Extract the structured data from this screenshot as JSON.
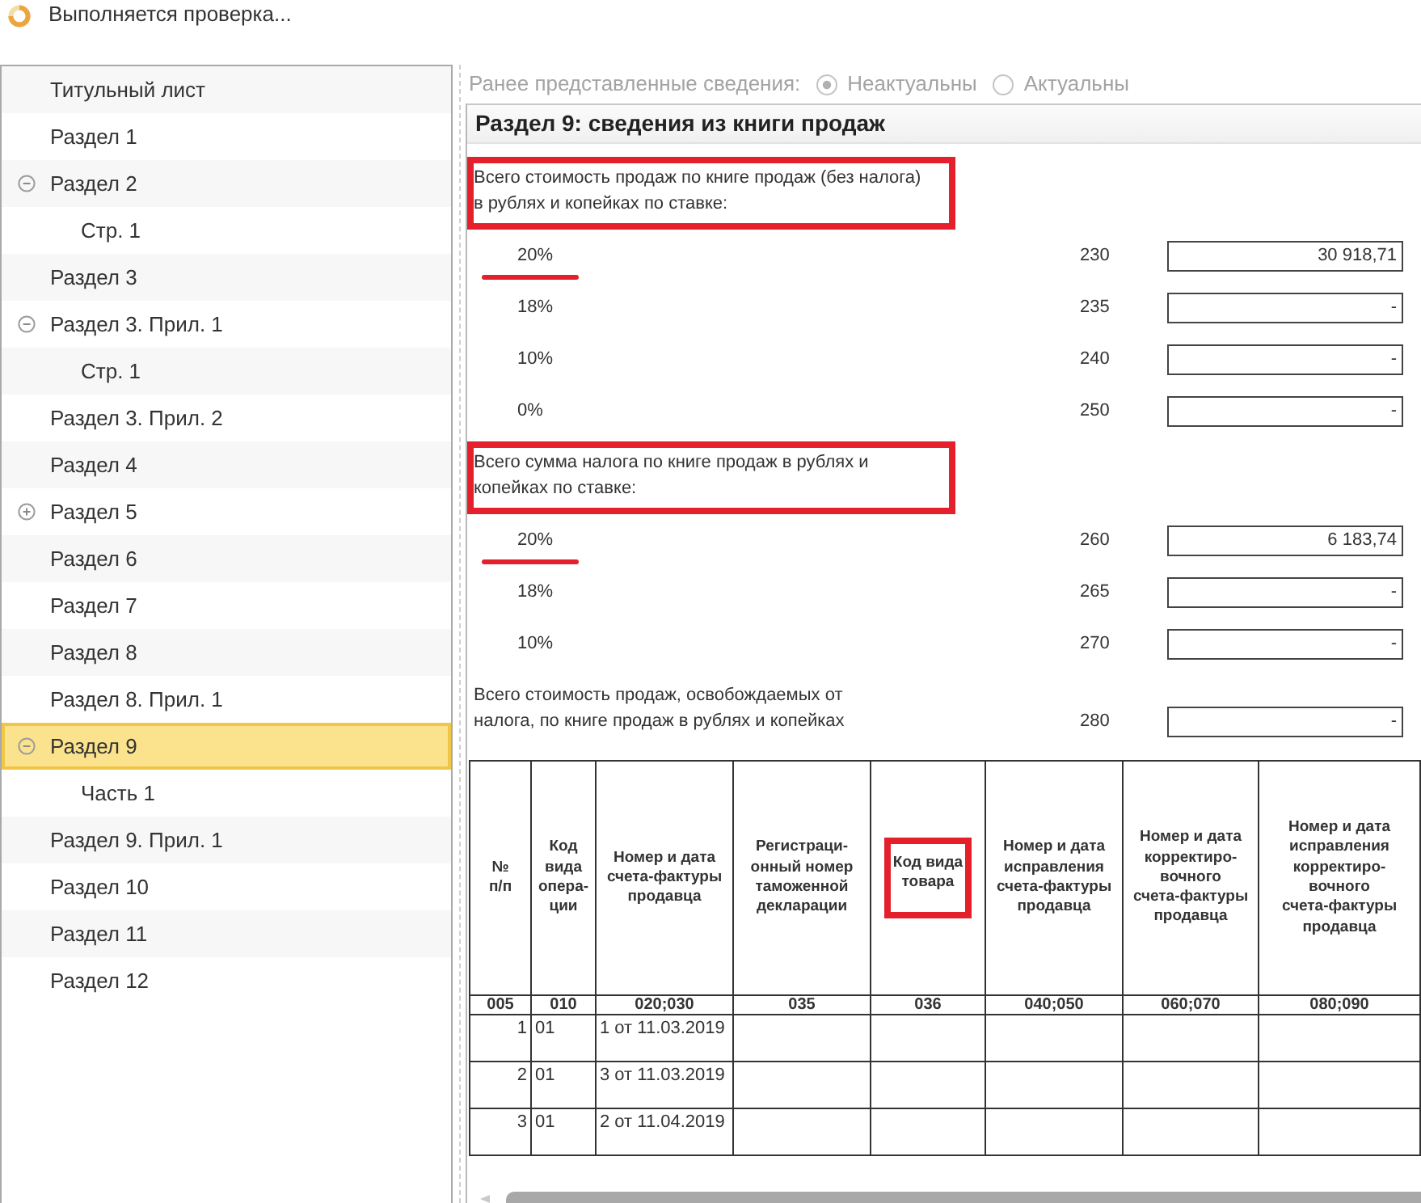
{
  "status": {
    "text": "Выполняется проверка..."
  },
  "sidebar": {
    "items": [
      {
        "label": "Титульный лист",
        "selected": false
      },
      {
        "label": "Раздел 1",
        "selected": false
      },
      {
        "label": "Раздел 2",
        "selected": false,
        "expanded": true,
        "children": [
          {
            "label": "Стр. 1",
            "selected": false
          }
        ]
      },
      {
        "label": "Раздел 3",
        "selected": false
      },
      {
        "label": "Раздел 3. Прил. 1",
        "selected": false,
        "expanded": true,
        "children": [
          {
            "label": "Стр. 1",
            "selected": false
          }
        ]
      },
      {
        "label": "Раздел 3. Прил. 2",
        "selected": false
      },
      {
        "label": "Раздел 4",
        "selected": false
      },
      {
        "label": "Раздел 5",
        "selected": false,
        "expanded": false
      },
      {
        "label": "Раздел 6",
        "selected": false
      },
      {
        "label": "Раздел 7",
        "selected": false
      },
      {
        "label": "Раздел 8",
        "selected": false
      },
      {
        "label": "Раздел 8. Прил. 1",
        "selected": false
      },
      {
        "label": "Раздел 9",
        "selected": true,
        "expanded": true,
        "children": [
          {
            "label": "Часть 1",
            "selected": false
          }
        ]
      },
      {
        "label": "Раздел 9. Прил. 1",
        "selected": false
      },
      {
        "label": "Раздел 10",
        "selected": false
      },
      {
        "label": "Раздел 11",
        "selected": false
      },
      {
        "label": "Раздел 12",
        "selected": false
      }
    ]
  },
  "previous_data": {
    "label": "Ранее представленные сведения:",
    "disabled": true,
    "options": [
      {
        "label": "Неактуальны",
        "selected": true
      },
      {
        "label": "Актуальны",
        "selected": false
      }
    ]
  },
  "form": {
    "title": "Раздел 9: сведения из книги продаж",
    "groups": [
      {
        "kind": "rates",
        "label": "Всего стоимость продаж по книге продаж (без налога) в рублях и копейках по ставке:",
        "annotated": true,
        "rates": [
          {
            "rate": "20%",
            "code": "230",
            "value": "30 918,71",
            "underlined": true
          },
          {
            "rate": "18%",
            "code": "235",
            "value": "-",
            "underlined": false
          },
          {
            "rate": "10%",
            "code": "240",
            "value": "-",
            "underlined": false
          },
          {
            "rate": "0%",
            "code": "250",
            "value": "-",
            "underlined": false
          }
        ]
      },
      {
        "kind": "rates",
        "label": "Всего сумма налога по книге продаж в рублях и копейках по ставке:",
        "annotated": true,
        "rates": [
          {
            "rate": "20%",
            "code": "260",
            "value": "6 183,74",
            "underlined": true
          },
          {
            "rate": "18%",
            "code": "265",
            "value": "-",
            "underlined": false
          },
          {
            "rate": "10%",
            "code": "270",
            "value": "-",
            "underlined": false
          }
        ]
      },
      {
        "kind": "line",
        "label": "Всего стоимость продаж, освобождаемых от налога, по книге продаж в рублях и копейках",
        "annotated": false,
        "code": "280",
        "value": "-"
      }
    ],
    "table": {
      "columns": [
        {
          "header": "№\nп/п",
          "code": "005",
          "annotated": false
        },
        {
          "header": "Код\nвида\nопера-\nции",
          "code": "010",
          "annotated": false
        },
        {
          "header": "Номер и дата\nсчета-фактуры\nпродавца",
          "code": "020;030",
          "annotated": false
        },
        {
          "header": "Регистраци-\nонный номер\nтаможенной\nдекларации",
          "code": "035",
          "annotated": false
        },
        {
          "header": "Код вида\nтовара",
          "code": "036",
          "annotated": true
        },
        {
          "header": "Номер и дата\nисправления\nсчета-фактуры\nпродавца",
          "code": "040;050",
          "annotated": false
        },
        {
          "header": "Номер и дата\nкорректиро-\nвочного\nсчета-фактуры\nпродавца",
          "code": "060;070",
          "annotated": false
        },
        {
          "header": "Номер и дата\nисправления\nкорректиро-\nвочного\nсчета-фактуры\nпродавца",
          "code": "080;090",
          "annotated": false
        }
      ],
      "rows": [
        {
          "cells": [
            "1",
            "01",
            "1 от 11.03.2019"
          ]
        },
        {
          "cells": [
            "2",
            "01",
            "3 от 11.03.2019"
          ]
        },
        {
          "cells": [
            "3",
            "01",
            "2 от 11.04.2019"
          ]
        }
      ]
    }
  }
}
